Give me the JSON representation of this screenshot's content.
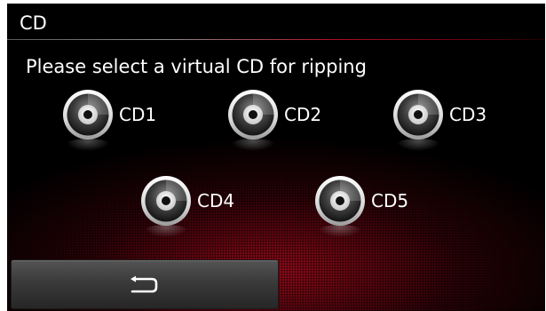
{
  "header": {
    "title": "CD"
  },
  "main": {
    "prompt": "Please select a virtual CD for ripping",
    "cds": [
      {
        "label": "CD1",
        "icon": "disc-icon"
      },
      {
        "label": "CD2",
        "icon": "disc-icon"
      },
      {
        "label": "CD3",
        "icon": "disc-icon"
      },
      {
        "label": "CD4",
        "icon": "disc-icon"
      },
      {
        "label": "CD5",
        "icon": "disc-icon"
      }
    ]
  },
  "footer": {
    "back_icon": "return-arrow-icon"
  },
  "colors": {
    "background": "#000000",
    "accent_red": "#b01020",
    "text": "#ffffff",
    "button": "#3a3a3a"
  }
}
